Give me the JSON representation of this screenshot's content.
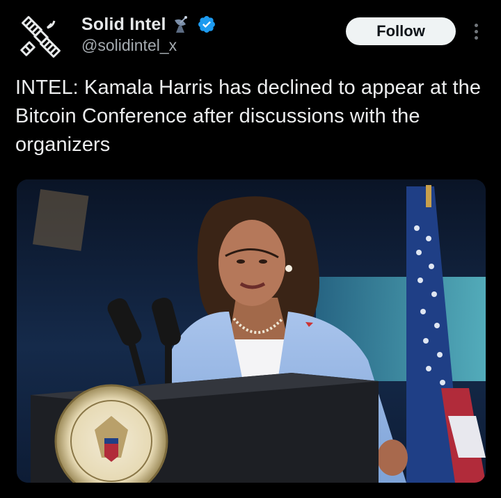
{
  "post": {
    "author": {
      "display_name": "Solid Intel",
      "handle": "@solidintel_x",
      "avatar_icon": "satellite-icon",
      "name_emoji_icon": "satellite-dish-icon",
      "verified_icon": "verified-badge-icon"
    },
    "follow_label": "Follow",
    "more_icon": "more-options-icon",
    "text": "INTEL: Kamala Harris has declined to appear at the Bitcoin Conference after discussions with the organizers",
    "media": {
      "type": "photo"
    }
  },
  "colors": {
    "background": "#000000",
    "text_primary": "#e7e9ea",
    "text_secondary": "#a5abb0",
    "follow_bg": "#eff3f4",
    "verified_blue": "#1d9bf0"
  }
}
